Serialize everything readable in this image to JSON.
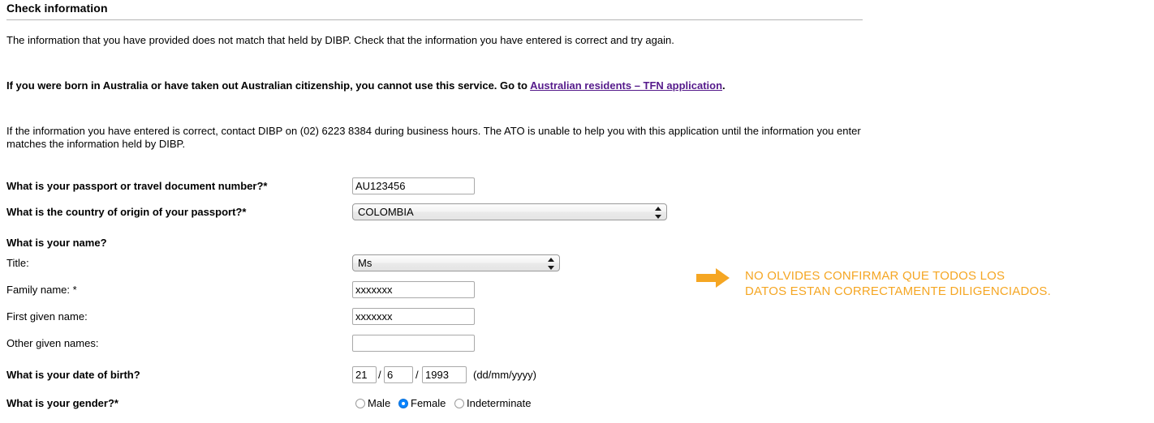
{
  "page": {
    "heading": "Check information",
    "paragraphs": {
      "intro": "The information that you have provided does not match that held by DIBP. Check that the information you have entered is correct and try again.",
      "warning_prefix": "If you were born in Australia or have taken out Australian citizenship, you cannot use this service. Go to ",
      "warning_link": "Australian residents – TFN application",
      "warning_suffix": ".",
      "final": "If the information you have entered is correct, contact DIBP on (02) 6223 8384 during business hours. The ATO is unable to help you with this application until the information you enter matches the information held by DIBP."
    }
  },
  "form": {
    "passport_number": {
      "label": "What is your passport or travel document number?*",
      "value": "AU123456"
    },
    "country_of_origin": {
      "label": "What is the country of origin of your passport?*",
      "value": "COLOMBIA"
    },
    "name_section": {
      "heading": "What is your name?",
      "title": {
        "label": "Title:",
        "value": "Ms"
      },
      "family_name": {
        "label": "Family name: *",
        "value": "xxxxxxx"
      },
      "first_given_name": {
        "label": "First given name:",
        "value": "xxxxxxx"
      },
      "other_given_names": {
        "label": "Other given names:",
        "value": ""
      }
    },
    "date_of_birth": {
      "label": "What is your date of birth?",
      "day": "21",
      "month": "6",
      "year": "1993",
      "separator": "/",
      "hint": "(dd/mm/yyyy)"
    },
    "gender": {
      "label": "What is your gender?*",
      "options": [
        {
          "label": "Male",
          "selected": false
        },
        {
          "label": "Female",
          "selected": true
        },
        {
          "label": "Indeterminate",
          "selected": false
        }
      ]
    }
  },
  "annotation": {
    "icon": "arrow-right-icon",
    "line1": "NO OLVIDES CONFIRMAR QUE TODOS LOS",
    "line2": "DATOS ESTAN CORRECTAMENTE DILIGENCIADOS."
  },
  "colors": {
    "annotation": "#f5a623",
    "link": "#551a8b",
    "radio_selected": "#0a84ff",
    "rule": "#b5b5b5"
  }
}
